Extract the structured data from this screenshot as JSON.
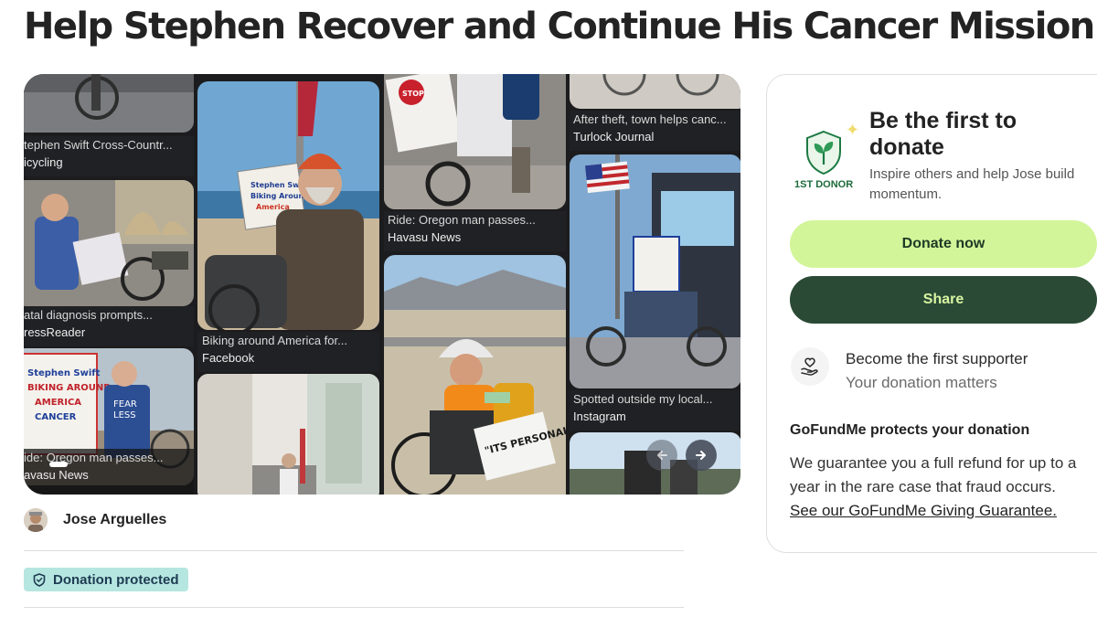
{
  "page": {
    "title": "Help Stephen Recover and Continue His Cancer Mission"
  },
  "gallery": {
    "tiles": [
      {
        "title": "tephen Swift Cross-Countr...",
        "source": "icycling"
      },
      {
        "title": "atal diagnosis prompts...",
        "source": "ressReader"
      },
      {
        "title": "ide: Oregon man passes...",
        "source": "avasu News"
      },
      {
        "title": "Biking around America for...",
        "source": "Facebook"
      },
      {
        "title": "Ride: Oregon man passes...",
        "source": "Havasu News"
      },
      {
        "title": "After theft, town helps canc...",
        "source": "Turlock Journal"
      },
      {
        "title": "Spotted outside my local...",
        "source": "Instagram"
      }
    ],
    "photo_texts": {
      "sign_a": "Stephen Swift Biking Around America",
      "sign_b": "\"ITS PERSONAL\"",
      "shirt": "FEAR LESS",
      "sign_c": "Stephen Swift BIKING AROUND AMERICA CANCER AWARENESS",
      "stop_sign": "STOP"
    },
    "prev_icon": "arrow-left-icon",
    "next_icon": "arrow-right-icon"
  },
  "organizer": {
    "name": "Jose Arguelles"
  },
  "badge": {
    "label": "Donation protected",
    "icon": "shield-icon"
  },
  "donate_card": {
    "badge_label": "1ST DONOR",
    "heading": "Be the first to donate",
    "subtext": "Inspire others and help Jose build momentum.",
    "donate_label": "Donate now",
    "share_label": "Share",
    "supporter_title": "Become the first supporter",
    "supporter_sub": "Your donation matters",
    "protect_title": "GoFundMe protects your donation",
    "protect_body": "We guarantee you a full refund for up to a year in the rare case that fraud occurs.",
    "protect_link": "See our GoFundMe Giving Guarantee."
  },
  "colors": {
    "donate_button": "#d3f59a",
    "share_button": "#2b4a36",
    "badge_bg": "#b6e6e0"
  }
}
